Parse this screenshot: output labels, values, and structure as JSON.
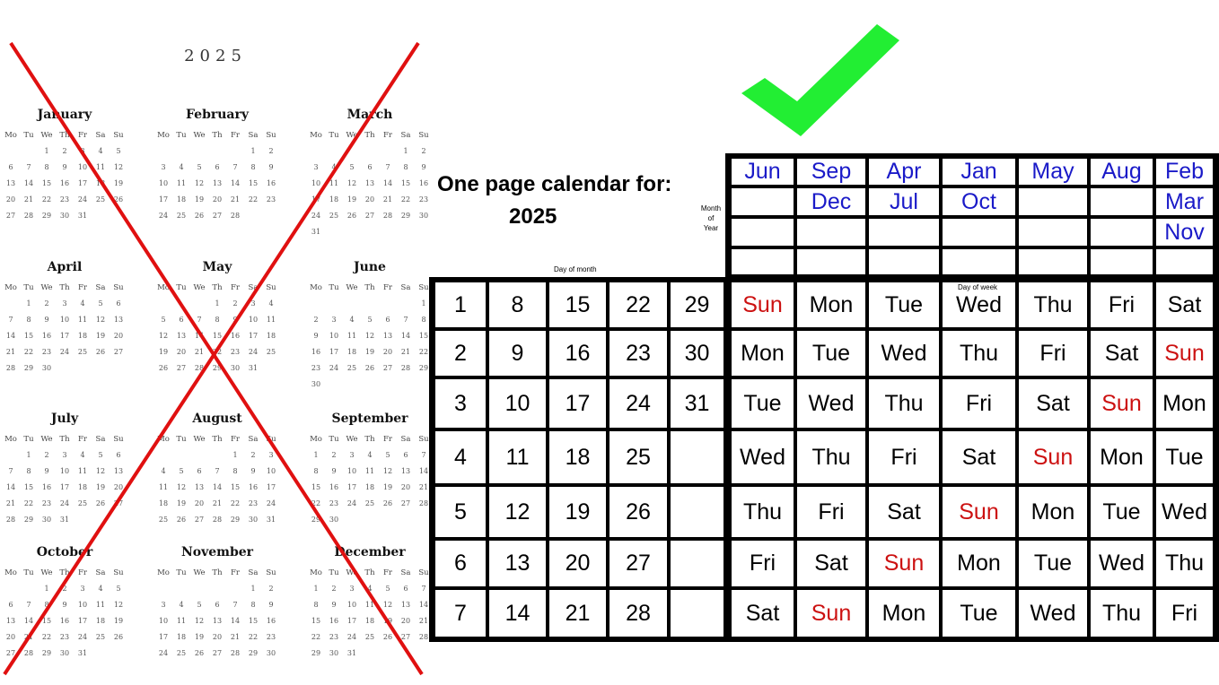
{
  "old_calendar": {
    "year": "2025",
    "weekday_headers": [
      "Mo",
      "Tu",
      "We",
      "Th",
      "Fr",
      "Sa",
      "Su"
    ],
    "months": [
      {
        "name": "January",
        "offset": 2,
        "days": 31
      },
      {
        "name": "February",
        "offset": 5,
        "days": 28
      },
      {
        "name": "March",
        "offset": 5,
        "days": 31
      },
      {
        "name": "April",
        "offset": 1,
        "days": 30
      },
      {
        "name": "May",
        "offset": 3,
        "days": 31
      },
      {
        "name": "June",
        "offset": 6,
        "days": 30
      },
      {
        "name": "July",
        "offset": 1,
        "days": 31
      },
      {
        "name": "August",
        "offset": 4,
        "days": 31
      },
      {
        "name": "September",
        "offset": 0,
        "days": 30
      },
      {
        "name": "October",
        "offset": 2,
        "days": 31
      },
      {
        "name": "November",
        "offset": 5,
        "days": 30
      },
      {
        "name": "December",
        "offset": 0,
        "days": 31
      }
    ],
    "status": "rejected",
    "cross_color": "#e01010"
  },
  "new_calendar": {
    "status": "approved",
    "check_color": "#22ee33",
    "title_line1": "One page calendar for:",
    "title_line2": "2025",
    "month_of_year_label": [
      "Month",
      "of",
      "Year"
    ],
    "day_of_month_label": "Day of month",
    "day_of_week_label": "Day of week",
    "month_color": "#1a1ac8",
    "sunday_color": "#cc1111",
    "month_columns": [
      [
        "Jun",
        "",
        "",
        ""
      ],
      [
        "Sep",
        "Dec",
        "",
        ""
      ],
      [
        "Apr",
        "Jul",
        "",
        ""
      ],
      [
        "Jan",
        "Oct",
        "",
        ""
      ],
      [
        "May",
        "",
        "",
        ""
      ],
      [
        "Aug",
        "",
        "",
        ""
      ],
      [
        "Feb",
        "Mar",
        "Nov",
        ""
      ]
    ],
    "day_of_month_rows": [
      [
        "1",
        "8",
        "15",
        "22",
        "29"
      ],
      [
        "2",
        "9",
        "16",
        "23",
        "30"
      ],
      [
        "3",
        "10",
        "17",
        "24",
        "31"
      ],
      [
        "4",
        "11",
        "18",
        "25",
        ""
      ],
      [
        "5",
        "12",
        "19",
        "26",
        ""
      ],
      [
        "6",
        "13",
        "20",
        "27",
        ""
      ],
      [
        "7",
        "14",
        "21",
        "28",
        ""
      ]
    ],
    "day_of_week_rows": [
      [
        "Sun",
        "Mon",
        "Tue",
        "Wed",
        "Thu",
        "Fri",
        "Sat"
      ],
      [
        "Mon",
        "Tue",
        "Wed",
        "Thu",
        "Fri",
        "Sat",
        "Sun"
      ],
      [
        "Tue",
        "Wed",
        "Thu",
        "Fri",
        "Sat",
        "Sun",
        "Mon"
      ],
      [
        "Wed",
        "Thu",
        "Fri",
        "Sat",
        "Sun",
        "Mon",
        "Tue"
      ],
      [
        "Thu",
        "Fri",
        "Sat",
        "Sun",
        "Mon",
        "Tue",
        "Wed"
      ],
      [
        "Fri",
        "Sat",
        "Sun",
        "Mon",
        "Tue",
        "Wed",
        "Thu"
      ],
      [
        "Sat",
        "Sun",
        "Mon",
        "Tue",
        "Wed",
        "Thu",
        "Fri"
      ]
    ]
  }
}
